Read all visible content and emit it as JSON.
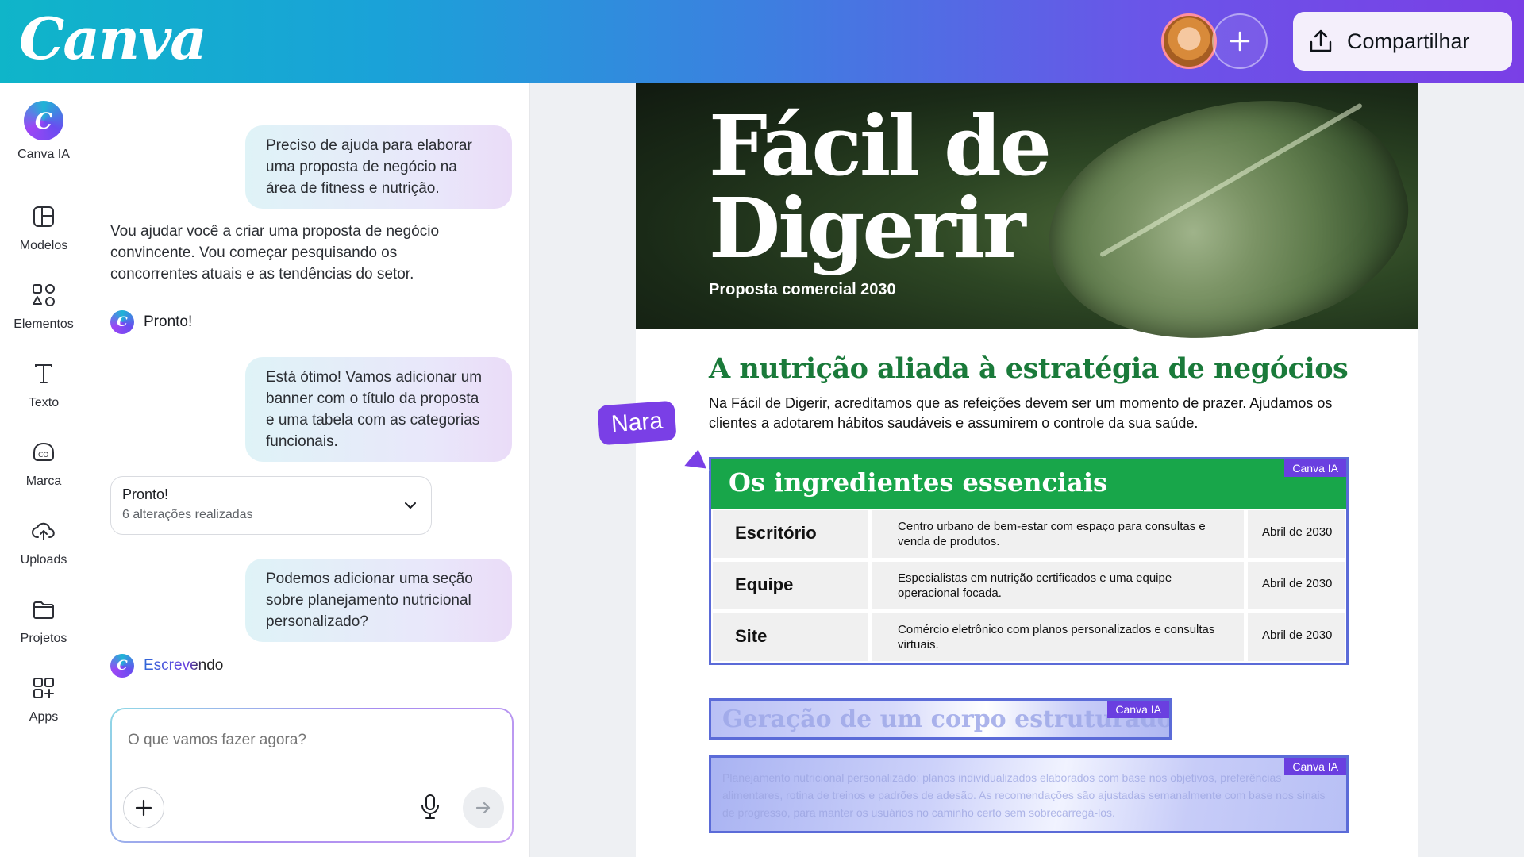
{
  "header": {
    "logo": "Canva",
    "share_label": "Compartilhar"
  },
  "rail": {
    "items": [
      {
        "label": "Canva IA",
        "icon": "canva-ai-icon"
      },
      {
        "label": "Modelos",
        "icon": "templates-icon"
      },
      {
        "label": "Elementos",
        "icon": "elements-icon"
      },
      {
        "label": "Texto",
        "icon": "text-icon"
      },
      {
        "label": "Marca",
        "icon": "brand-icon"
      },
      {
        "label": "Uploads",
        "icon": "upload-cloud-icon"
      },
      {
        "label": "Projetos",
        "icon": "folder-icon"
      },
      {
        "label": "Apps",
        "icon": "apps-icon"
      }
    ]
  },
  "chat": {
    "msg1": "Preciso de ajuda para elaborar uma proposta de negócio na área de fitness e nutrição.",
    "reply1": "Vou ajudar você a criar uma proposta de negócio convincente. Vou começar pesquisando os concorrentes atuais e as tendências do setor.",
    "status1": "Pronto!",
    "msg2": "Está ótimo! Vamos adicionar um banner com o título da proposta e uma tabela com as categorias funcionais.",
    "done_title": "Pronto!",
    "done_sub": "6 alterações realizadas",
    "msg3": "Podemos adicionar uma seção sobre planejamento nutricional personalizado?",
    "writing": "Escrevendo",
    "input_placeholder": "O que vamos fazer agora?"
  },
  "doc": {
    "banner_title_line1": "Fácil de",
    "banner_title_line2": "Digerir",
    "banner_subtitle": "Proposta comercial 2030",
    "section_title": "A nutrição aliada à estratégia de negócios",
    "intro": "Na Fácil de Digerir, acreditamos que as refeições devem ser um momento de prazer. Ajudamos os clientes a adotarem hábitos saudáveis e assumirem o controle da sua saúde.",
    "table_title": "Os ingredientes essenciais",
    "ai_tag": "Canva IA",
    "rows": [
      {
        "name": "Escritório",
        "desc": "Centro urbano de bem-estar com espaço para consultas e venda de produtos.",
        "date": "Abril de 2030"
      },
      {
        "name": "Equipe",
        "desc": "Especialistas em nutrição certificados e uma equipe operacional focada.",
        "date": "Abril de 2030"
      },
      {
        "name": "Site",
        "desc": "Comércio eletrônico com planos personalizados e consultas virtuais.",
        "date": "Abril de 2030"
      }
    ],
    "generating_title": "Geração de um corpo estruturado",
    "generating_body": "Planejamento nutricional personalizado: planos individualizados elaborados com base nos objetivos, preferências alimentares, rotina de treinos e padrões de adesão. As recomendações são ajustadas semanalmente com base nos sinais de progresso, para manter os usuários no caminho certo sem sobrecarregá-los.",
    "collaborator": "Nara"
  },
  "colors": {
    "accent_purple": "#7a3fe6",
    "table_green": "#18a64a",
    "title_green": "#1a7a3a",
    "selection_blue": "#5b6bd8"
  }
}
